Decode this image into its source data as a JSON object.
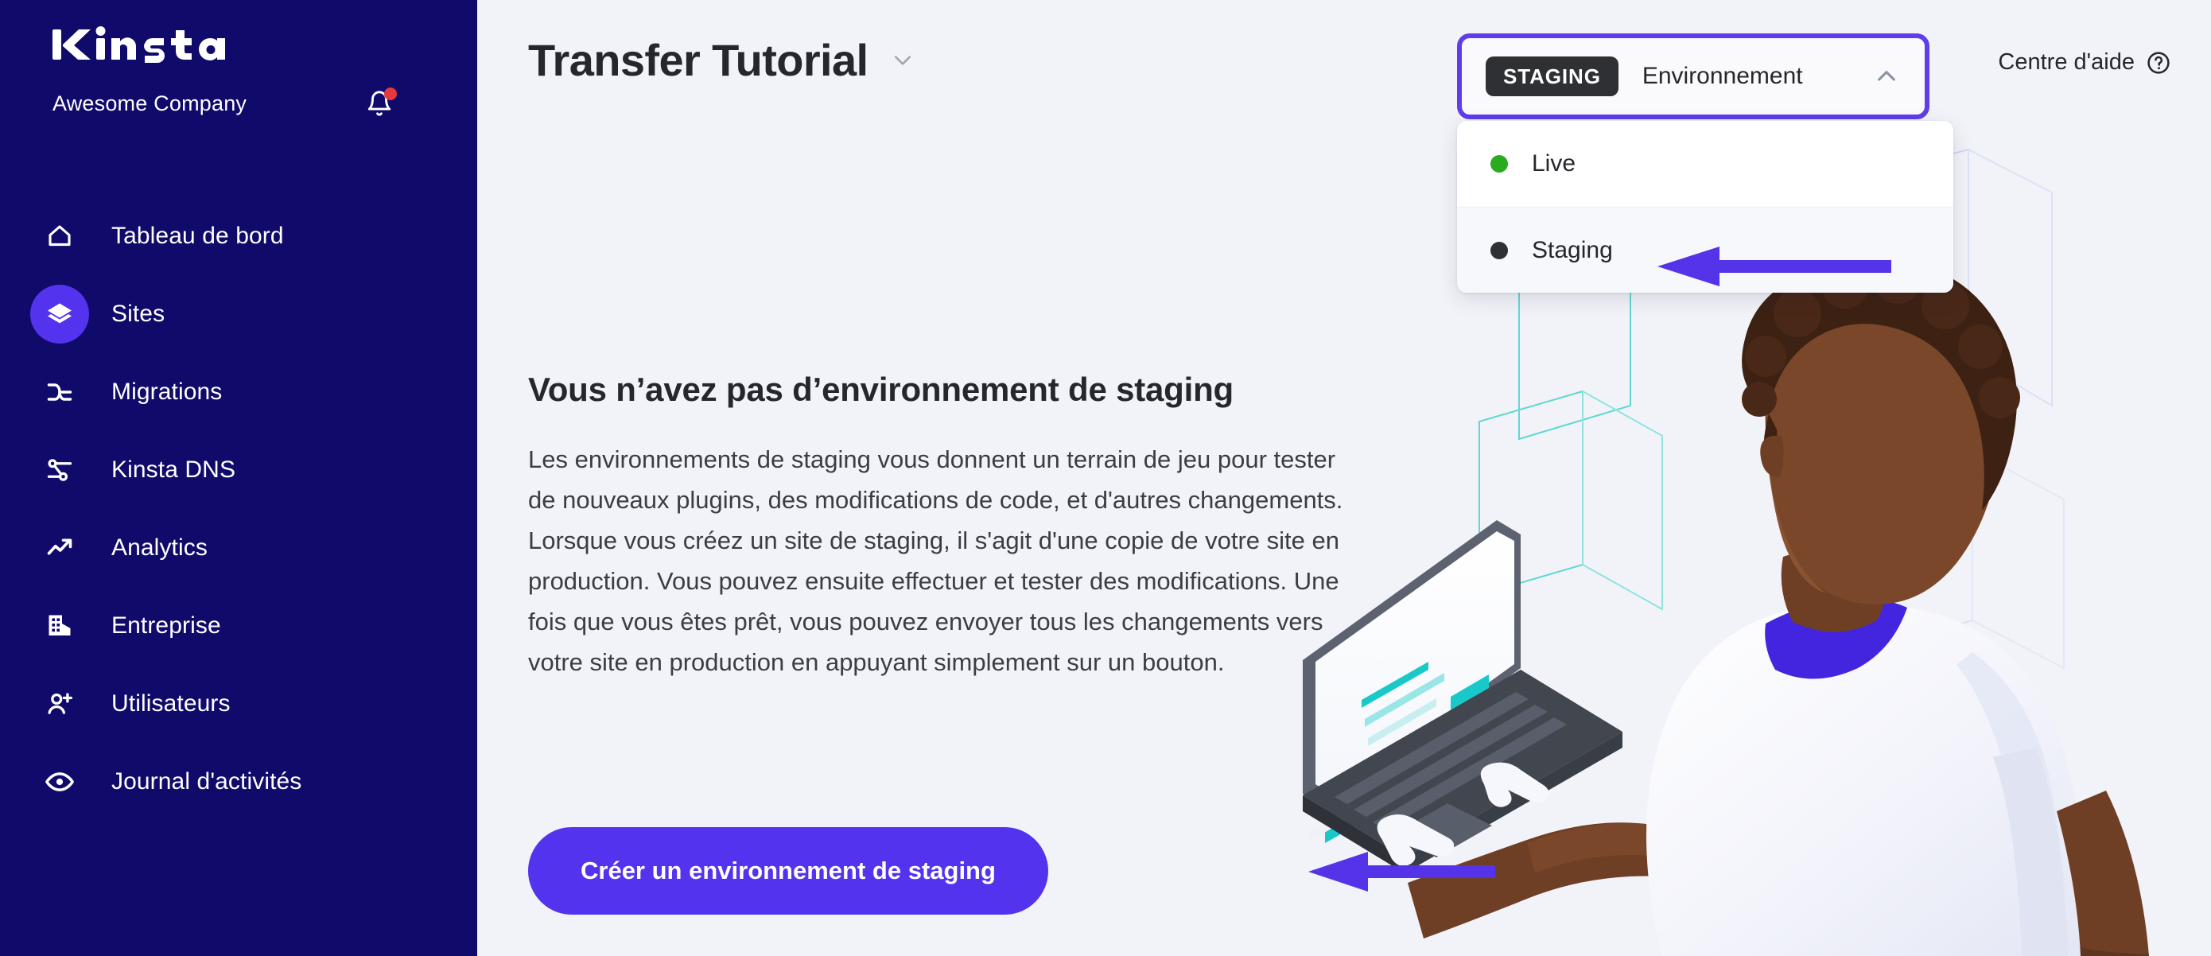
{
  "sidebar": {
    "logo_text": "Kinsta",
    "company": "Awesome Company",
    "notification_icon": "bell-icon",
    "has_notification_dot": true,
    "items": [
      {
        "label": "Tableau de bord",
        "icon": "home-icon",
        "active": false
      },
      {
        "label": "Sites",
        "icon": "layers-icon",
        "active": true
      },
      {
        "label": "Migrations",
        "icon": "migration-icon",
        "active": false
      },
      {
        "label": "Kinsta DNS",
        "icon": "dns-nodes-icon",
        "active": false
      },
      {
        "label": "Analytics",
        "icon": "trending-up-icon",
        "active": false
      },
      {
        "label": "Entreprise",
        "icon": "building-icon",
        "active": false
      },
      {
        "label": "Utilisateurs",
        "icon": "user-plus-icon",
        "active": false
      },
      {
        "label": "Journal d'activités",
        "icon": "eye-icon",
        "active": false
      }
    ]
  },
  "header": {
    "title": "Transfer Tutorial",
    "title_caret_icon": "chevron-down-icon",
    "help_label": "Centre d'aide",
    "help_icon": "question-circle-icon"
  },
  "env_selector": {
    "badge": "STAGING",
    "label": "Environnement",
    "caret_icon": "chevron-up-icon",
    "expanded": true,
    "options": [
      {
        "label": "Live",
        "dot_color": "#2aaa1e",
        "selected": false
      },
      {
        "label": "Staging",
        "dot_color": "#2f3033",
        "selected": true
      }
    ]
  },
  "main": {
    "heading": "Vous n’avez pas d’environnement de staging",
    "paragraph": "Les environnements de staging vous donnent un terrain de jeu pour tester de nouveaux plugins, des modifications de code, et d'autres changements. Lorsque vous créez un site de staging, il s'agit d'une copie de votre site en production. Vous pouvez ensuite effectuer et tester des modifications. Une fois que vous êtes prêt, vous pouvez envoyer tous les changements vers votre site en production en appuyant simplement sur un bouton.",
    "cta_label": "Créer un environnement de staging"
  },
  "annotations": [
    {
      "name": "arrow-to-staging-option",
      "direction": "left"
    },
    {
      "name": "arrow-to-create-staging-button",
      "direction": "left"
    }
  ],
  "illustration": {
    "name": "person-at-laptop-illustration",
    "alt": "Illustration d'une personne travaillant sur un ordinateur portable"
  },
  "colors": {
    "sidebar_bg": "#100a6b",
    "accent_purple": "#5333ed",
    "annotation_purple": "#5533e8",
    "page_bg": "#f2f3f8",
    "badge_dark": "#2f3033",
    "live_green": "#2aaa1e",
    "notification_red": "#e8383d",
    "text_dark": "#26272d"
  }
}
